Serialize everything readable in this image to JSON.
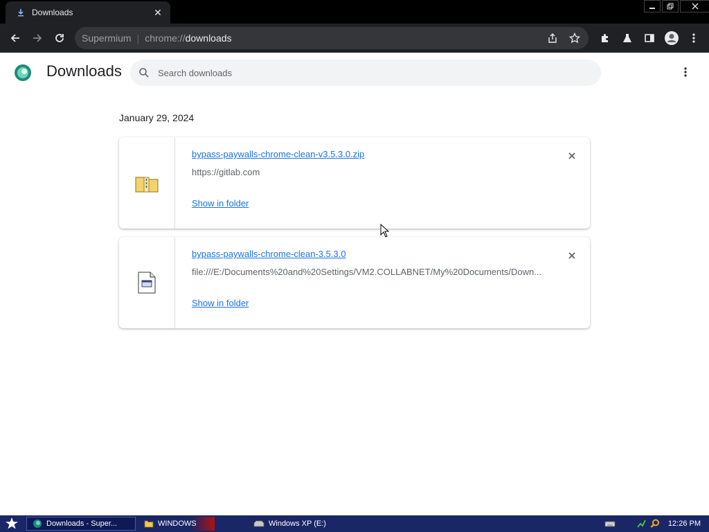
{
  "browser": {
    "tab_title": "Downloads",
    "omnibox": {
      "host": "Supermium",
      "scheme": "chrome://",
      "path": "downloads"
    }
  },
  "page": {
    "title": "Downloads",
    "search_placeholder": "Search downloads",
    "date_heading": "January 29, 2024"
  },
  "downloads": [
    {
      "filename": "bypass-paywalls-chrome-clean-v3.5.3.0.zip",
      "url": "https://gitlab.com",
      "action": "Show in folder",
      "icon": "zip-folder-icon"
    },
    {
      "filename": "bypass-paywalls-chrome-clean-3.5.3.0",
      "url": "file:///E:/Documents%20and%20Settings/VM2.COLLABNET/My%20Documents/Down...",
      "action": "Show in folder",
      "icon": "generic-file-icon"
    }
  ],
  "taskbar": {
    "tasks": [
      {
        "label": "Downloads - Super..."
      },
      {
        "label": "WINDOWS"
      },
      {
        "label": "Windows XP (E:)"
      }
    ],
    "clock": "12:26 PM"
  },
  "colors": {
    "link": "#1a73e8",
    "toolbar": "#202124",
    "taskbar": "#1a2766"
  }
}
